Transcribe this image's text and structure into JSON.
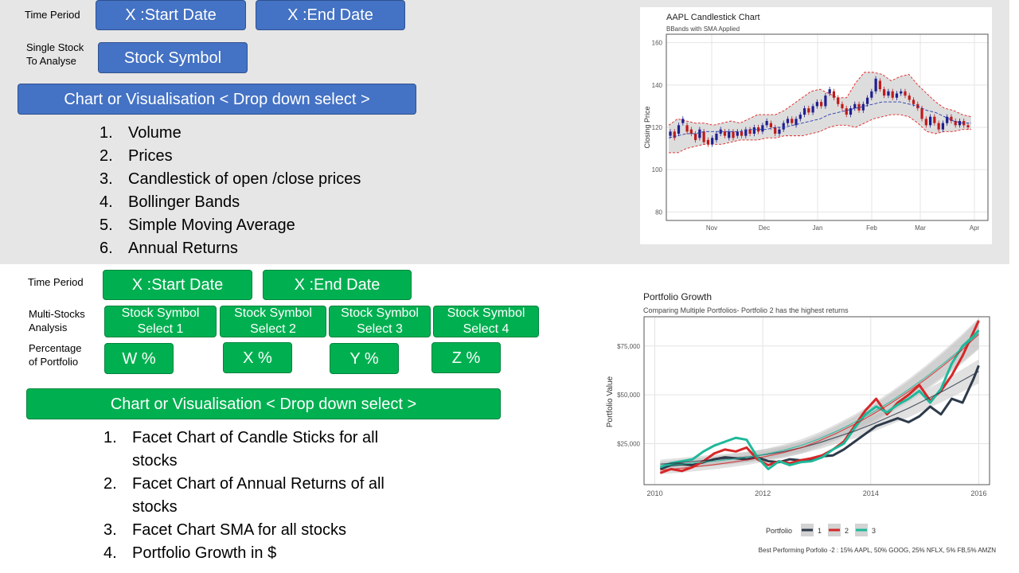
{
  "top": {
    "time_period_label": "Time Period",
    "start_button": "X :Start Date",
    "end_button": "X :End Date",
    "single_stock_label_1": "Single Stock",
    "single_stock_label_2": "To Analyse",
    "symbol_button": "Stock Symbol",
    "chart_select": "Chart or Visualisation < Drop down select >",
    "options": [
      {
        "n": "1.",
        "t": "Volume"
      },
      {
        "n": "2.",
        "t": "Prices"
      },
      {
        "n": "3.",
        "t": "Candlestick of open /close prices"
      },
      {
        "n": "4.",
        "t": "Bollinger Bands"
      },
      {
        "n": "5.",
        "t": "Simple Moving Average"
      },
      {
        "n": "6.",
        "t": "Annual Returns"
      }
    ]
  },
  "bottom": {
    "time_period_label": "Time Period",
    "start_button": "X :Start Date",
    "end_button": "X :End Date",
    "multi_label_1": "Multi-Stocks",
    "multi_label_2": "Analysis",
    "symbols": [
      {
        "a": "Stock Symbol",
        "b": "Select 1"
      },
      {
        "a": "Stock Symbol",
        "b": "Select 2"
      },
      {
        "a": "Stock Symbol",
        "b": "Select 3"
      },
      {
        "a": "Stock Symbol",
        "b": "Select 4"
      }
    ],
    "pct_label_1": "Percentage",
    "pct_label_2": "of Portfolio",
    "weights": [
      "W %",
      "X %",
      "Y %",
      "Z %"
    ],
    "chart_select": "Chart or Visualisation < Drop down select >",
    "options": [
      {
        "n": "1.",
        "t1": "Facet Chart of Candle Sticks for all",
        "t2": "stocks"
      },
      {
        "n": "2.",
        "t1": "Facet Chart of Annual Returns of all",
        "t2": "stocks"
      },
      {
        "n": "3.",
        "t1": "Facet Chart SMA for all stocks",
        "t2": ""
      },
      {
        "n": "4.",
        "t1": "Portfolio Growth in $",
        "t2": ""
      }
    ]
  },
  "colors": {
    "blue_button": "#4472c4",
    "green_button": "#00b050",
    "band": "#e7e6e6",
    "portfolio_1": "#2e3a4a",
    "portfolio_2": "#d62728",
    "portfolio_3": "#1fb89a"
  },
  "chart_data": [
    {
      "type": "line",
      "title": "AAPL Candlestick Chart",
      "subtitle": "BBands with SMA Applied",
      "xlabel": "",
      "ylabel": "Closing Price",
      "x_ticks": [
        "Nov",
        "Dec",
        "Jan",
        "Feb",
        "Mar",
        "Apr"
      ],
      "y_ticks": [
        80,
        100,
        120,
        140,
        160
      ],
      "ylim": [
        76,
        164
      ],
      "grid": true,
      "candles": [
        {
          "o": 116,
          "c": 118
        },
        {
          "o": 118,
          "c": 115
        },
        {
          "o": 117,
          "c": 121
        },
        {
          "o": 122,
          "c": 124
        },
        {
          "o": 121,
          "c": 118
        },
        {
          "o": 119,
          "c": 117
        },
        {
          "o": 117,
          "c": 114
        },
        {
          "o": 115,
          "c": 119
        },
        {
          "o": 118,
          "c": 113
        },
        {
          "o": 114,
          "c": 112
        },
        {
          "o": 112,
          "c": 115
        },
        {
          "o": 114,
          "c": 117
        },
        {
          "o": 117,
          "c": 119
        },
        {
          "o": 118,
          "c": 116
        },
        {
          "o": 115,
          "c": 118
        },
        {
          "o": 118,
          "c": 115
        },
        {
          "o": 116,
          "c": 118
        },
        {
          "o": 118,
          "c": 116
        },
        {
          "o": 116,
          "c": 119
        },
        {
          "o": 119,
          "c": 117
        },
        {
          "o": 117,
          "c": 120
        },
        {
          "o": 120,
          "c": 118
        },
        {
          "o": 118,
          "c": 121
        },
        {
          "o": 121,
          "c": 123
        },
        {
          "o": 122,
          "c": 120
        },
        {
          "o": 120,
          "c": 117
        },
        {
          "o": 117,
          "c": 119
        },
        {
          "o": 119,
          "c": 122
        },
        {
          "o": 122,
          "c": 124
        },
        {
          "o": 124,
          "c": 122
        },
        {
          "o": 121,
          "c": 124
        },
        {
          "o": 124,
          "c": 126
        },
        {
          "o": 126,
          "c": 129
        },
        {
          "o": 129,
          "c": 127
        },
        {
          "o": 127,
          "c": 130
        },
        {
          "o": 130,
          "c": 132
        },
        {
          "o": 132,
          "c": 130
        },
        {
          "o": 130,
          "c": 135
        },
        {
          "o": 136,
          "c": 138
        },
        {
          "o": 137,
          "c": 134
        },
        {
          "o": 134,
          "c": 131
        },
        {
          "o": 131,
          "c": 129
        },
        {
          "o": 129,
          "c": 126
        },
        {
          "o": 126,
          "c": 129
        },
        {
          "o": 129,
          "c": 131
        },
        {
          "o": 131,
          "c": 128
        },
        {
          "o": 128,
          "c": 131
        },
        {
          "o": 131,
          "c": 134
        },
        {
          "o": 134,
          "c": 137
        },
        {
          "o": 137,
          "c": 143
        },
        {
          "o": 142,
          "c": 138
        },
        {
          "o": 138,
          "c": 135
        },
        {
          "o": 135,
          "c": 137
        },
        {
          "o": 137,
          "c": 134
        },
        {
          "o": 134,
          "c": 136
        },
        {
          "o": 136,
          "c": 137
        },
        {
          "o": 137,
          "c": 135
        },
        {
          "o": 135,
          "c": 133
        },
        {
          "o": 133,
          "c": 131
        },
        {
          "o": 131,
          "c": 129
        },
        {
          "o": 129,
          "c": 124
        },
        {
          "o": 124,
          "c": 121
        },
        {
          "o": 121,
          "c": 125
        },
        {
          "o": 125,
          "c": 122
        },
        {
          "o": 122,
          "c": 119
        },
        {
          "o": 119,
          "c": 122
        },
        {
          "o": 122,
          "c": 125
        },
        {
          "o": 125,
          "c": 123
        },
        {
          "o": 123,
          "c": 121
        },
        {
          "o": 121,
          "c": 123
        },
        {
          "o": 123,
          "c": 121
        },
        {
          "o": 121,
          "c": 120
        }
      ],
      "sma": [
        115,
        116,
        117,
        117,
        118,
        118,
        118,
        118,
        118,
        119,
        119,
        119,
        120,
        120,
        121,
        122,
        123,
        124,
        126,
        127,
        128,
        129,
        130,
        131,
        132,
        132,
        132,
        131,
        130,
        128,
        127,
        125,
        123,
        122,
        122
      ],
      "bb_upper": [
        121,
        124,
        123,
        122,
        122,
        121,
        122,
        123,
        122,
        124,
        126,
        126,
        126,
        128,
        131,
        134,
        137,
        138,
        136,
        134,
        134,
        141,
        146,
        146,
        145,
        142,
        144,
        145,
        140,
        136,
        132,
        129,
        128,
        126,
        125
      ],
      "bb_lower": [
        108,
        108,
        110,
        111,
        112,
        112,
        112,
        113,
        114,
        114,
        114,
        115,
        115,
        116,
        116,
        116,
        117,
        118,
        120,
        121,
        121,
        120,
        122,
        124,
        125,
        126,
        126,
        125,
        122,
        118,
        117,
        118,
        118,
        119,
        119
      ]
    },
    {
      "type": "line",
      "title": "Portfolio Growth",
      "subtitle": "Comparing Multiple Portfolios- Portfolio 2 has the highest returns",
      "xlabel": "",
      "ylabel": "Portfolio Value",
      "x_ticks": [
        "2010",
        "2012",
        "2014",
        "2016"
      ],
      "y_ticks": [
        "$25,000",
        "$50,000",
        "$75,000"
      ],
      "xlim": [
        2009.8,
        2016.2
      ],
      "ylim": [
        4000,
        90000
      ],
      "grid": true,
      "legend_title": "Portfolio",
      "legend_position": "bottom",
      "caption": "Best Performing Porfolio -2 : 15% AAPL, 50% GOOG, 25% NFLX, 5% FB,5% AMZN",
      "x": [
        2010.1,
        2010.3,
        2010.5,
        2010.7,
        2010.9,
        2011.1,
        2011.3,
        2011.5,
        2011.7,
        2011.9,
        2012.1,
        2012.3,
        2012.5,
        2012.7,
        2012.9,
        2013.1,
        2013.3,
        2013.5,
        2013.7,
        2013.9,
        2014.1,
        2014.3,
        2014.5,
        2014.7,
        2014.9,
        2015.1,
        2015.3,
        2015.5,
        2015.7,
        2015.9,
        2016.0
      ],
      "series": [
        {
          "name": "1",
          "values": [
            12000,
            14000,
            14500,
            14000,
            15500,
            17000,
            18000,
            17500,
            17000,
            18000,
            16000,
            15500,
            17000,
            16500,
            17000,
            18500,
            19000,
            22000,
            26000,
            30000,
            34000,
            36000,
            38000,
            36000,
            39000,
            44000,
            40000,
            48000,
            46000,
            58000,
            65000
          ]
        },
        {
          "name": "2",
          "values": [
            10000,
            12000,
            11000,
            13000,
            16000,
            20000,
            22000,
            21000,
            23000,
            17000,
            14000,
            16000,
            15000,
            16500,
            17500,
            19000,
            22000,
            26000,
            34000,
            42000,
            48000,
            40000,
            46000,
            50000,
            55000,
            47000,
            52000,
            60000,
            70000,
            82000,
            88000
          ]
        },
        {
          "name": "3",
          "values": [
            13000,
            15000,
            16000,
            17000,
            21000,
            24000,
            26000,
            28000,
            27000,
            18000,
            12000,
            16000,
            14000,
            15500,
            16000,
            18000,
            22000,
            25000,
            33000,
            40000,
            44000,
            41000,
            45000,
            48000,
            52000,
            46000,
            53000,
            66000,
            75000,
            80000,
            83000
          ]
        }
      ],
      "trend": [
        {
          "name": "1",
          "values": [
            14500,
            15200,
            16000,
            16800,
            17500,
            18300,
            19500,
            21000,
            23000,
            25500,
            28500,
            31500,
            35000,
            39000,
            43000,
            47500,
            52000,
            57000,
            62000
          ]
        },
        {
          "name": "2",
          "values": [
            11500,
            12200,
            13200,
            14200,
            15400,
            16800,
            18500,
            20500,
            23000,
            26500,
            30500,
            35000,
            40000,
            45500,
            51500,
            58000,
            65000,
            72500,
            81000
          ]
        },
        {
          "name": "3",
          "values": [
            13500,
            14300,
            15200,
            16000,
            17000,
            18200,
            19700,
            21700,
            24200,
            27500,
            31500,
            36000,
            41000,
            46500,
            52500,
            59000,
            66000,
            73500,
            81500
          ]
        }
      ]
    }
  ]
}
